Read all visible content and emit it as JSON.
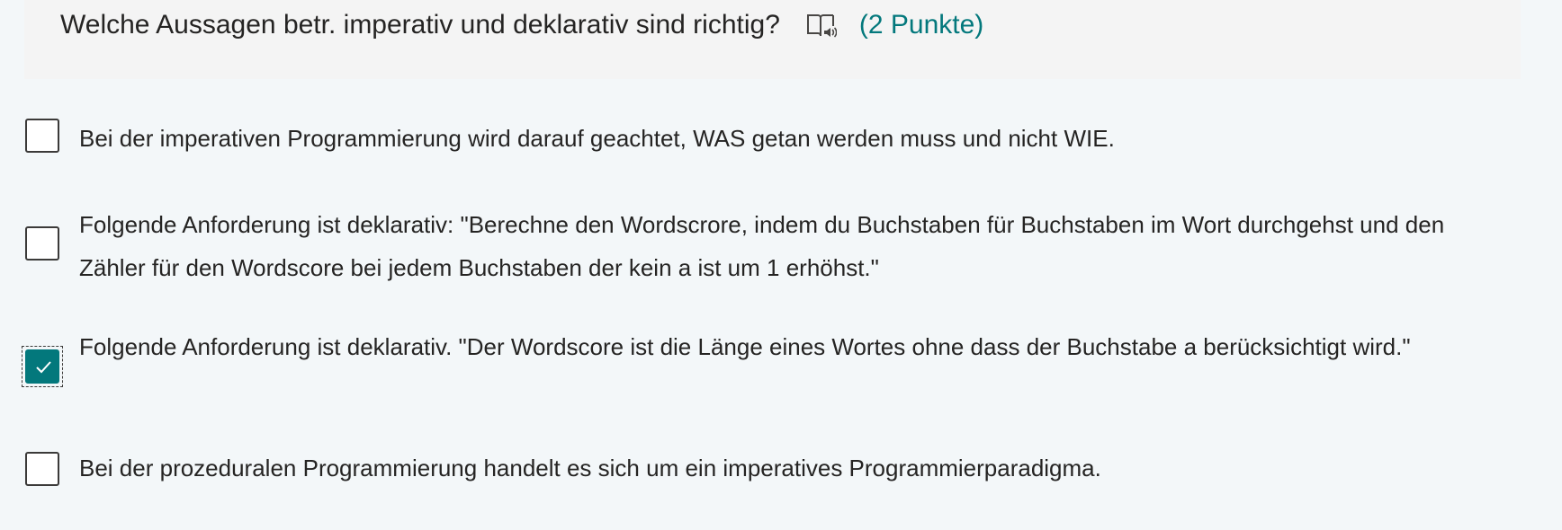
{
  "question": {
    "text": "Welche Aussagen betr. imperativ und deklarativ sind richtig?",
    "points": "(2 Punkte)",
    "reader_icon": "immersive-reader-icon"
  },
  "options": [
    {
      "label": "Bei der imperativen Programmierung wird darauf geachtet, WAS getan werden muss und nicht WIE.",
      "checked": false
    },
    {
      "label": "Folgende Anforderung ist deklarativ: \"Berechne den Wordscrore, indem du Buchstaben für Buchstaben im Wort durchgehst und den Zähler für den Wordscore bei jedem Buchstaben der kein a ist um 1 erhöhst.\"",
      "checked": false
    },
    {
      "label": "Folgende Anforderung ist deklarativ. \"Der Wordscore ist die Länge eines Wortes ohne dass der Buchstabe a berücksichtigt wird.\"",
      "checked": true
    },
    {
      "label": "Bei der prozeduralen Programmierung handelt es sich um ein imperatives Programmierparadigma.",
      "checked": false
    }
  ],
  "colors": {
    "accent": "#03787c",
    "background": "#f3f7f9",
    "header_background": "#f4f4f4",
    "text": "#252423"
  }
}
